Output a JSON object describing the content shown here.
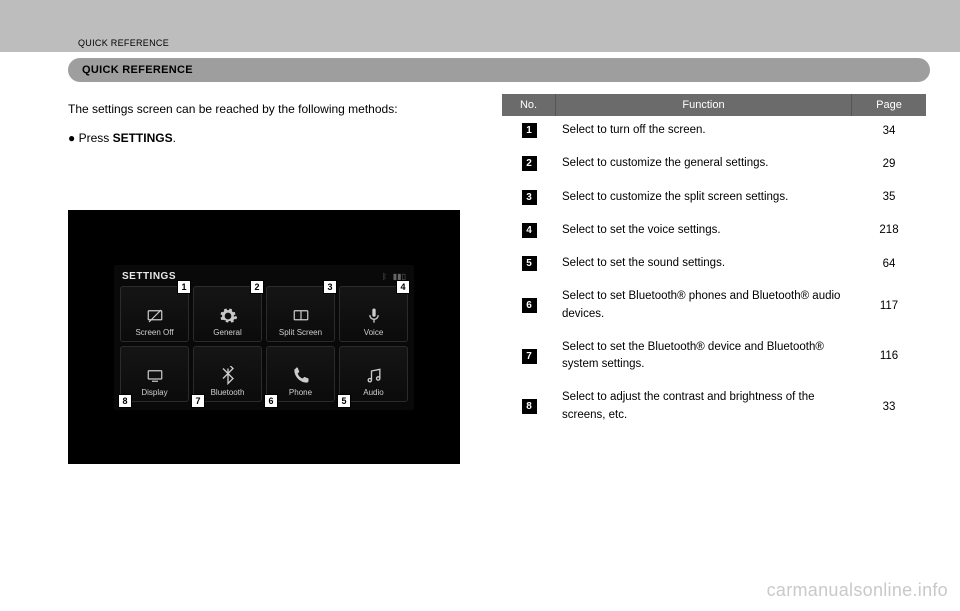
{
  "header": {
    "running_head": "QUICK REFERENCE",
    "chapter_title": "QUICK REFERENCE"
  },
  "intro": {
    "line1": "The settings screen can be reached by the following methods:",
    "bullet_prefix": "● Press ",
    "bullet_key": "SETTINGS",
    "bullet_suffix": "."
  },
  "infotainment": {
    "title": "SETTINGS",
    "tiles": [
      {
        "label": "Screen Off",
        "icon": "screen-off-icon",
        "tag_top": "1",
        "tag_bot": ""
      },
      {
        "label": "General",
        "icon": "gear-icon",
        "tag_top": "2",
        "tag_bot": ""
      },
      {
        "label": "Split Screen",
        "icon": "split-icon",
        "tag_top": "3",
        "tag_bot": ""
      },
      {
        "label": "Voice",
        "icon": "mic-icon",
        "tag_top": "4",
        "tag_bot": ""
      },
      {
        "label": "Display",
        "icon": "display-icon",
        "tag_top": "",
        "tag_bot": "8"
      },
      {
        "label": "Bluetooth",
        "icon": "bluetooth-icon",
        "tag_top": "",
        "tag_bot": "7"
      },
      {
        "label": "Phone",
        "icon": "phone-icon",
        "tag_top": "",
        "tag_bot": "6"
      },
      {
        "label": "Audio",
        "icon": "music-icon",
        "tag_top": "",
        "tag_bot": "5"
      }
    ]
  },
  "table": {
    "head": {
      "no": "No.",
      "function": "Function",
      "page": "Page"
    },
    "rows": [
      {
        "no": "1",
        "fn": "Select to turn off the screen.",
        "pg": "34"
      },
      {
        "no": "2",
        "fn": "Select to customize the general settings.",
        "pg": "29"
      },
      {
        "no": "3",
        "fn": "Select to customize the split screen settings.",
        "pg": "35"
      },
      {
        "no": "4",
        "fn": "Select to set the voice settings.",
        "pg": "218"
      },
      {
        "no": "5",
        "fn": "Select to set the sound settings.",
        "pg": "64"
      },
      {
        "no": "6",
        "fn": "Select to set Bluetooth® phones and Bluetooth® audio devices.",
        "pg": "117"
      },
      {
        "no": "7",
        "fn": "Select to set the Bluetooth® device and Bluetooth® system settings.",
        "pg": "116"
      },
      {
        "no": "8",
        "fn": "Select to adjust the contrast and brightness of the screens, etc.",
        "pg": "33"
      }
    ]
  },
  "watermark": "carmanualsonline.info"
}
